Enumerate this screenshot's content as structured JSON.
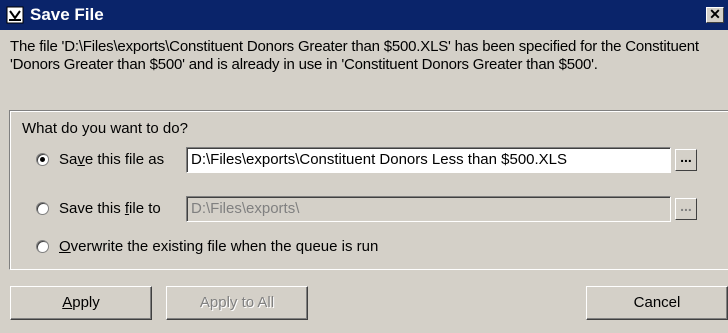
{
  "window": {
    "title": "Save File",
    "close_label": "✕"
  },
  "message": "The file 'D:\\Files\\exports\\Constituent Donors Greater than $500.XLS' has been specified for the Constituent 'Donors Greater than $500' and is already in use in 'Constituent Donors Greater than $500'.",
  "options": {
    "question": "What do you want to do?",
    "save_as": {
      "label_pre": "Sa",
      "label_u": "v",
      "label_post": "e this file as",
      "value": "D:\\Files\\exports\\Constituent Donors Less than $500.XLS",
      "checked": true
    },
    "save_to": {
      "label_pre": "Save this ",
      "label_u": "f",
      "label_post": "ile to",
      "value": "D:\\Files\\exports\\",
      "checked": false
    },
    "overwrite": {
      "label_u": "O",
      "label_post": "verwrite the existing file when the queue is run",
      "checked": false
    },
    "browse_label": "..."
  },
  "buttons": {
    "apply_u": "A",
    "apply_post": "pply",
    "apply_all": "Apply to All",
    "cancel": "Cancel"
  }
}
